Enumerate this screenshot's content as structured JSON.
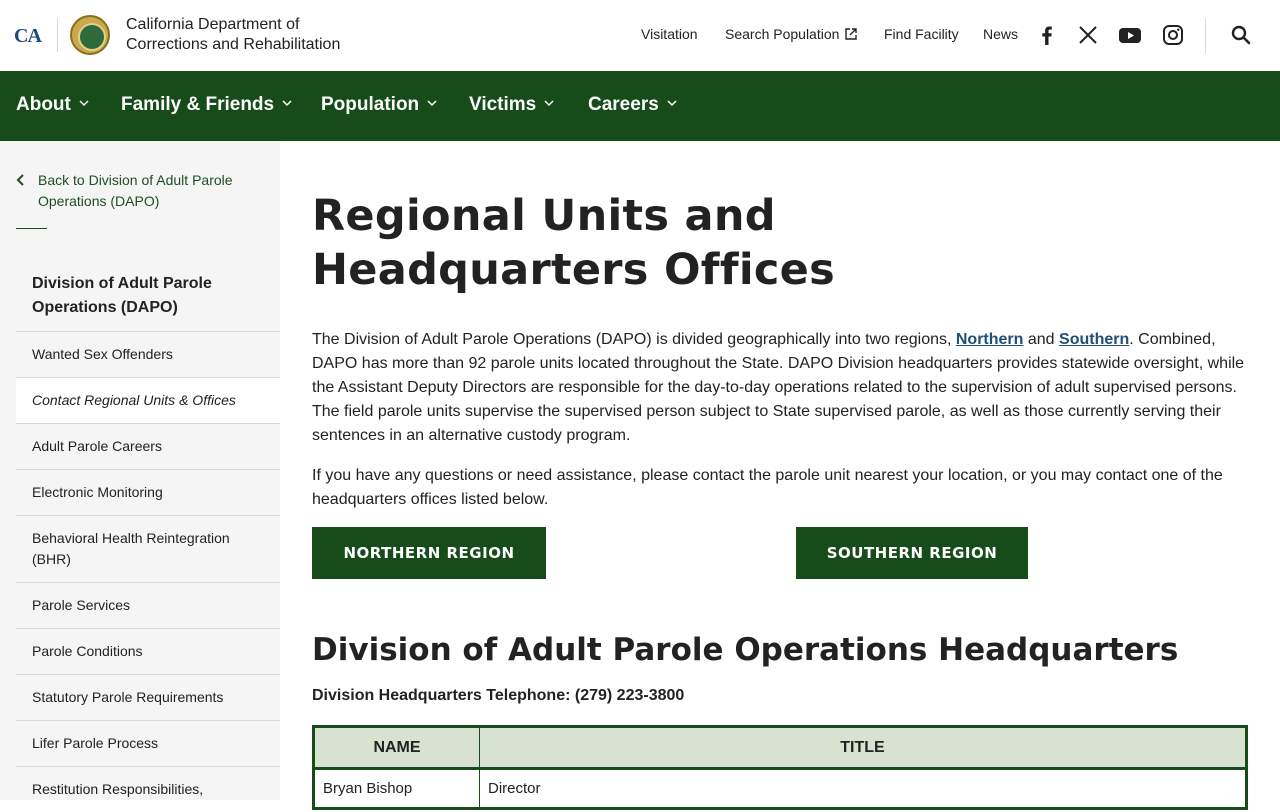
{
  "header": {
    "logo_ca": "CA",
    "dept_line1": "California Department of",
    "dept_line2": "Corrections and Rehabilitation",
    "top_nav": [
      "Visitation",
      "Search Population",
      "Find Facility",
      "News"
    ],
    "social_icons": [
      "facebook-icon",
      "x-icon",
      "youtube-icon",
      "instagram-icon"
    ]
  },
  "mainnav": {
    "items": [
      "About",
      "Family & Friends",
      "Population",
      "Victims",
      "Careers"
    ]
  },
  "sidebar": {
    "back_link": "Back to Division of Adult Parole Operations (DAPO)",
    "title": "Division of Adult Parole Operations (DAPO)",
    "items": [
      "Wanted Sex Offenders",
      "Contact Regional Units & Offices",
      "Adult Parole Careers",
      "Electronic Monitoring",
      "Behavioral Health Reintegration (BHR)",
      "Parole Services",
      "Parole Conditions",
      "Statutory Parole Requirements",
      "Lifer Parole Process",
      "Restitution Responsibilities,"
    ],
    "active_item": "Contact Regional Units & Offices"
  },
  "main": {
    "title": "Regional Units and Headquarters Offices",
    "para1_start": "The Division of Adult Parole Operations (DAPO) is divided geographically into two regions, ",
    "para1_link1": "Northern",
    "para1_and": " and ",
    "para1_link2": "Southern",
    "para1_end": ". Combined, DAPO has more than 92 parole units located throughout the State. DAPO Division headquarters provides statewide oversight, while the Assistant Deputy Directors are responsible for the day-to-day operations related to the supervision of adult supervised persons. The field parole units supervise the supervised person subject to State supervised parole, as well as those currently serving their sentences in an alternative custody program.",
    "para2": "If you have any questions or need assistance, please contact the parole unit nearest your location, or you may contact one of the headquarters offices listed below.",
    "northern_button": "NORTHERN REGION",
    "southern_button": "SOUTHERN REGION",
    "section_title": "Division of Adult Parole Operations Headquarters",
    "hq_phone": "Division Headquarters Telephone: (279) 223-3800",
    "table": {
      "headers": [
        "NAME",
        "TITLE"
      ],
      "rows": [
        [
          "Bryan Bishop",
          "Director"
        ]
      ]
    }
  },
  "colors": {
    "brand_green": "#174b19",
    "link_blue": "#1f4e79",
    "table_header_bg": "#d7e2d0",
    "sidebar_bg": "#f5f5f5"
  }
}
